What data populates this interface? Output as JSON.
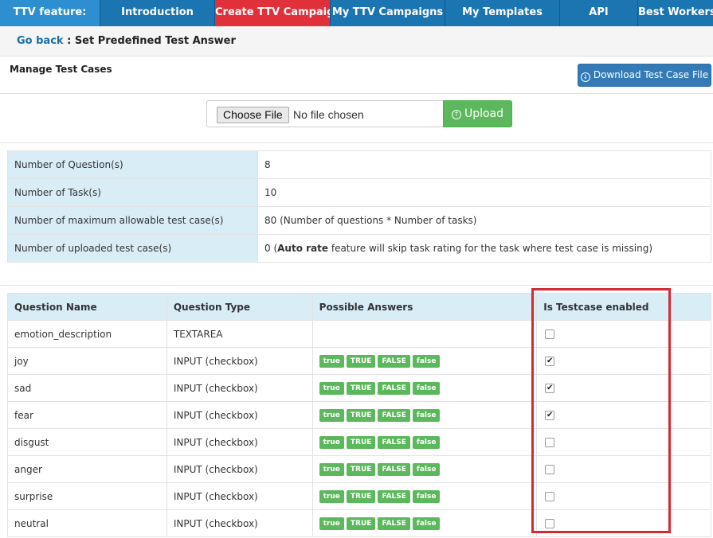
{
  "nav": {
    "feature": "TTV feature:",
    "items": [
      "Introduction",
      "Create TTV Campaign",
      "My TTV Campaigns",
      "My Templates",
      "API",
      "Best Workers"
    ]
  },
  "breadcrumb": {
    "back": "Go back",
    "title": " : Set Predefined Test Answer"
  },
  "manage": {
    "title": "Manage Test Cases",
    "download_label": "Download Test Case File"
  },
  "upload": {
    "choose_label": "Choose File",
    "file_status": "No file chosen",
    "upload_label": "Upload"
  },
  "info": {
    "rows": [
      {
        "label": "Number of Question(s)",
        "value": "8"
      },
      {
        "label": "Number of Task(s)",
        "value": "10"
      },
      {
        "label": "Number of maximum allowable test case(s)",
        "value": "80 (Number of questions * Number of tasks)"
      },
      {
        "label": "Number of uploaded test case(s)",
        "value_prefix": "0 (",
        "value_bold": "Auto rate",
        "value_suffix": " feature will skip task rating for the task where test case is missing)"
      }
    ]
  },
  "questions": {
    "headers": [
      "Question Name",
      "Question Type",
      "Possible Answers",
      "Is Testcase enabled"
    ],
    "answer_badges": [
      "true",
      "TRUE",
      "FALSE",
      "false"
    ],
    "rows": [
      {
        "name": "emotion_description",
        "type": "TEXTAREA",
        "answers": false,
        "enabled": false
      },
      {
        "name": "joy",
        "type": "INPUT (checkbox)",
        "answers": true,
        "enabled": true
      },
      {
        "name": "sad",
        "type": "INPUT (checkbox)",
        "answers": true,
        "enabled": true
      },
      {
        "name": "fear",
        "type": "INPUT (checkbox)",
        "answers": true,
        "enabled": true
      },
      {
        "name": "disgust",
        "type": "INPUT (checkbox)",
        "answers": true,
        "enabled": false
      },
      {
        "name": "anger",
        "type": "INPUT (checkbox)",
        "answers": true,
        "enabled": false
      },
      {
        "name": "surprise",
        "type": "INPUT (checkbox)",
        "answers": true,
        "enabled": false
      },
      {
        "name": "neutral",
        "type": "INPUT (checkbox)",
        "answers": true,
        "enabled": false
      }
    ]
  },
  "colors": {
    "nav": "#1a75b0",
    "active": "#e0303a",
    "accent_green": "#5cb85c",
    "highlight": "#d42a33"
  }
}
